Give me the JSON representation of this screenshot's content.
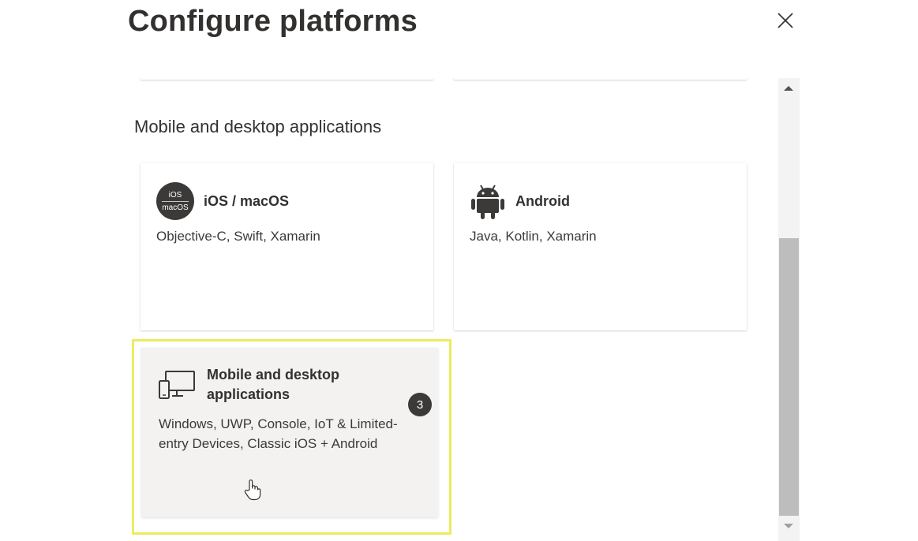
{
  "dialog": {
    "title": "Configure platforms",
    "close_icon": "close-icon"
  },
  "section": {
    "heading": "Mobile and desktop applications"
  },
  "cards": {
    "ios": {
      "icon": "ios-macos-icon",
      "icon_line1": "iOS",
      "icon_line2": "macOS",
      "title": "iOS / macOS",
      "description": "Objective-C, Swift, Xamarin"
    },
    "android": {
      "icon": "android-icon",
      "title": "Android",
      "description": "Java, Kotlin, Xamarin"
    },
    "mobile_desktop": {
      "icon": "devices-icon",
      "title": "Mobile and desktop applications",
      "description": "Windows, UWP, Console, IoT & Limited-entry Devices, Classic iOS + Android",
      "step_badge": "3",
      "highlighted": true
    }
  },
  "colors": {
    "highlight_border": "#ecec5e",
    "selected_card_bg": "#f3f2f1",
    "badge_bg": "#3b3a39"
  }
}
